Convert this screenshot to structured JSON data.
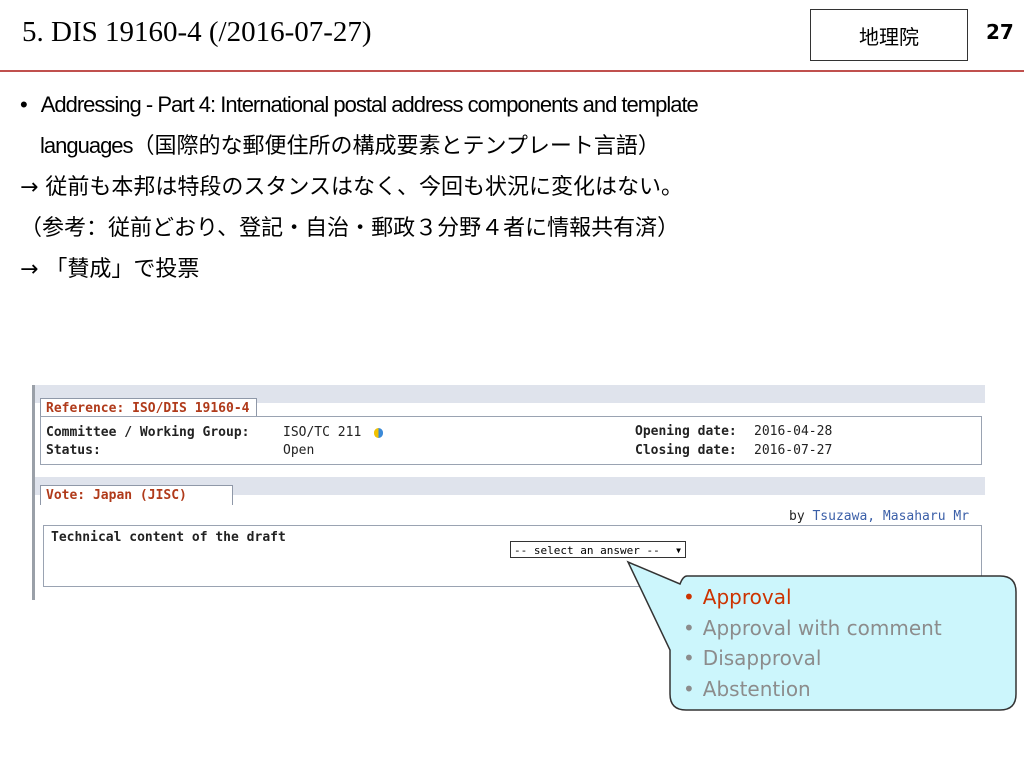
{
  "slide": {
    "title": "5. DIS 19160-4 (/2016-07-27)",
    "badge": "地理院",
    "page_number": "27"
  },
  "body": {
    "bullet": "•",
    "line1_en": "Addressing - Part 4: International postal address components and template",
    "line2_en": "languages",
    "line2_jp": "（国際的な郵便住所の構成要素とテンプレート言語）",
    "line3": "→ 従前も本邦は特段のスタンスはなく、今回も状況に変化はない。",
    "line4": "（参考：従前どおり、登記・自治・郵政３分野４者に情報共有済）",
    "line5": "→ 「賛成」で投票"
  },
  "vote_panel": {
    "reference_tab": "Reference: ISO/DIS 19160-4",
    "committee_label": "Committee / Working Group:",
    "committee_value": "ISO/TC 211",
    "status_label": "Status:",
    "status_value": "Open",
    "opening_label": "Opening date:",
    "opening_value": "2016-04-28",
    "closing_label": "Closing date:",
    "closing_value": "2016-07-27",
    "vote_tab": "Vote: Japan (JISC)",
    "by_label": "by",
    "by_value": "Tsuzawa, Masaharu Mr",
    "question": "Technical content of the draft",
    "select_value": "-- select an answer --",
    "select_arrow": "▼"
  },
  "callout": {
    "options": [
      "Approval",
      "Approval with comment",
      "Disapproval",
      "Abstention"
    ],
    "selected_index": 0
  },
  "colors": {
    "rule": "#c0504d",
    "tab_text": "#b03a1a",
    "callout_fill": "#ccf6fc",
    "callout_selected": "#cc3300",
    "callout_other": "#8c8c8c"
  }
}
